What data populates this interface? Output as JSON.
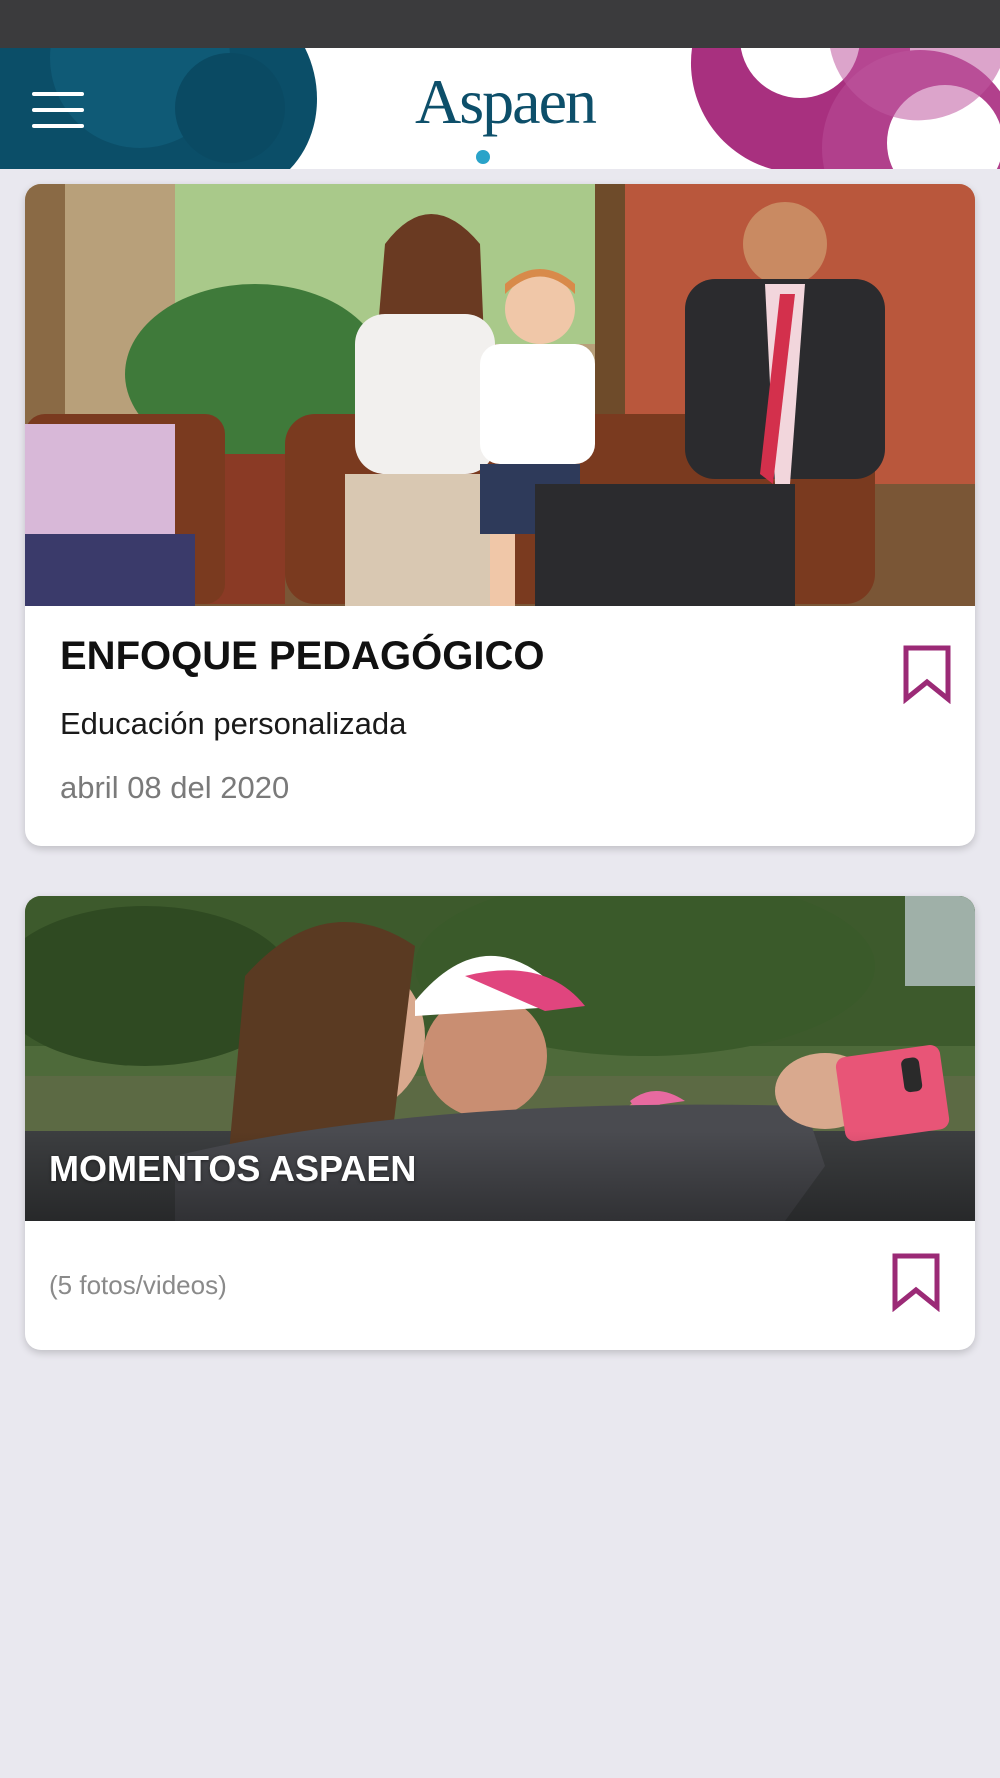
{
  "header": {
    "logo_text": "Aspaen",
    "menu_icon": "hamburger-menu-icon",
    "colors": {
      "teal": "#0b4e68",
      "magenta": "#a8307f",
      "background": "#e9e8ef"
    }
  },
  "posts": [
    {
      "title": "ENFOQUE PEDAGÓGICO",
      "subtitle": "Educación personalizada",
      "date": "abril 08 del 2020",
      "bookmark_icon": "bookmark-outline-icon"
    },
    {
      "title": "MOMENTOS ASPAEN",
      "media_count": "(5 fotos/videos)",
      "bookmark_icon": "bookmark-outline-icon"
    }
  ]
}
